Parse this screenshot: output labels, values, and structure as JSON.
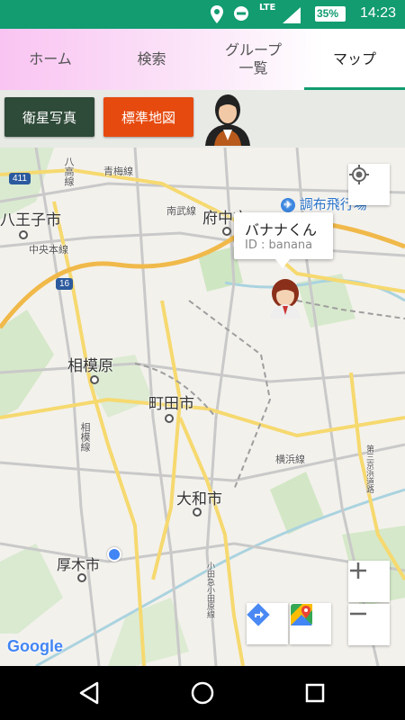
{
  "status_bar": {
    "network": "LTE",
    "battery": "35%",
    "time": "14:23"
  },
  "tabs": [
    {
      "label": "ホーム"
    },
    {
      "label": "検索"
    },
    {
      "label": "グループ\n一覧"
    },
    {
      "label": "マップ"
    }
  ],
  "active_tab": "マップ",
  "toolbar": {
    "satellite_label": "衛星写真",
    "standard_label": "標準地図",
    "colors": {
      "satellite": "#2e4a38",
      "standard": "#e64a0f"
    }
  },
  "map": {
    "places": {
      "hachioji": "八王子市",
      "fuchu": "府中市",
      "chofu_airport": "調布飛行場",
      "sagamihara": "相模原",
      "machida": "町田市",
      "yamato": "大和市",
      "atsugi": "厚木市"
    },
    "route_badges": {
      "r411": "411",
      "r16": "16"
    },
    "small_labels": {
      "hachiouji_line": "八高線",
      "ome_line": "青梅線",
      "nambu_line": "南武線",
      "chuo_line": "中央本線",
      "sagami_line": "相模線",
      "yokohama_line": "横浜線",
      "odakyu_line": "小田急小田原線",
      "tomei": "第三京浜道路"
    },
    "marker_callout": {
      "name": "バナナくん",
      "id": "ID : banana"
    },
    "google_logo": "Google"
  },
  "icons": {
    "my_location": "crosshair-icon",
    "directions": "directions-icon",
    "maps_app": "google-maps-icon",
    "zoom_in": "plus-icon",
    "zoom_out": "minus-icon"
  }
}
